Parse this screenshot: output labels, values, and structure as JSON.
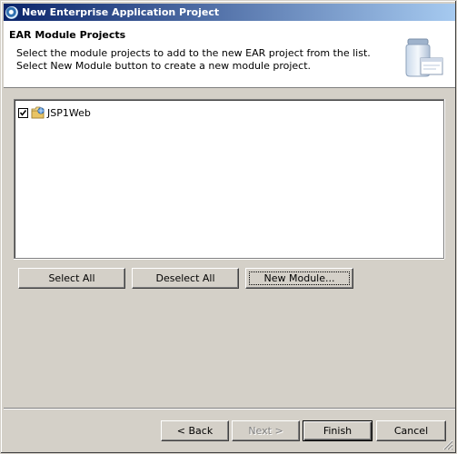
{
  "window": {
    "title": "New Enterprise Application Project",
    "icon": "eclipse-wizard-icon"
  },
  "header": {
    "heading": "EAR Module Projects",
    "description_line1": "Select the module projects to add to the new EAR project from the list.",
    "description_line2": "Select New Module button to create a new module project.",
    "icon": "ear-jar-wizard-icon"
  },
  "module_list": {
    "items": [
      {
        "label": "JSP1Web",
        "checked": true,
        "icon": "web-project-folder-icon"
      }
    ]
  },
  "list_buttons": {
    "select_all": "Select All",
    "deselect_all": "Deselect All",
    "new_module": "New Module..."
  },
  "wizard_buttons": {
    "back": "< Back",
    "next": "Next >",
    "finish": "Finish",
    "cancel": "Cancel",
    "next_enabled": false
  },
  "colors": {
    "titlebar_start": "#0a246a",
    "titlebar_end": "#a6caf0",
    "dialog_bg": "#d4d0c8"
  }
}
